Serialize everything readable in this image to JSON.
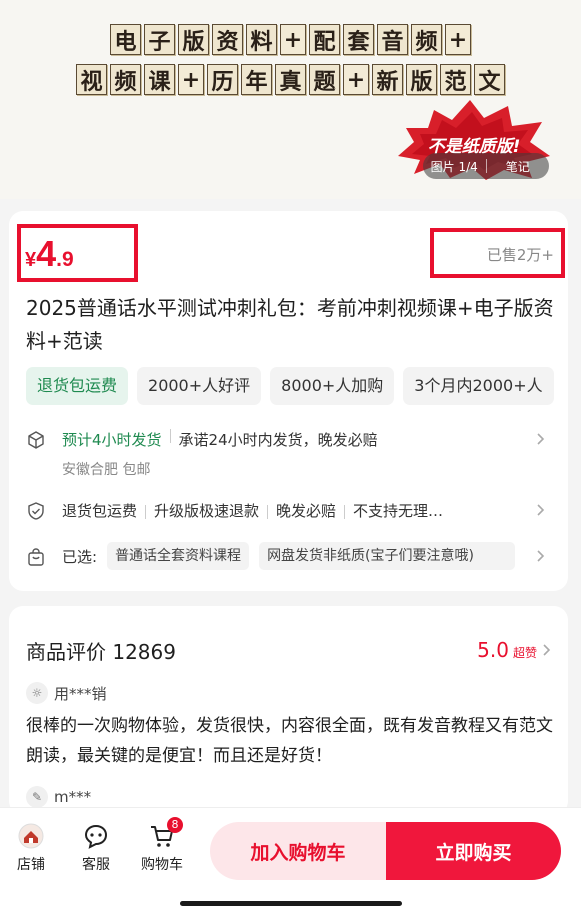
{
  "banner": {
    "title_line1": [
      "电",
      "子",
      "版",
      "资",
      "料",
      "+",
      "配",
      "套",
      "音",
      "频",
      "+"
    ],
    "title_line2": [
      "视",
      "频",
      "课",
      "+",
      "历",
      "年",
      "真",
      "题",
      "+",
      "新",
      "版",
      "范",
      "文"
    ],
    "burst_text": "不是纸质版!",
    "image_counter": "图片 1/4",
    "notes_label": "笔记"
  },
  "product": {
    "currency": "¥",
    "price_int": "4",
    "price_dec": ".9",
    "sold": "已售2万+",
    "title": "2025普通话水平测试冲刺礼包：考前冲刺视频课+电子版资料+范读",
    "tags": [
      "退货包运费",
      "2000+人好评",
      "8000+人加购",
      "3个月内2000+人"
    ],
    "delivery_highlight": "预计4小时发货",
    "delivery_promise": "承诺24小时内发货，晚发必赔",
    "shipping_from": "安徽合肥 包邮",
    "services": [
      "退货包运费",
      "升级版极速退款",
      "晚发必赔",
      "不支持无理…"
    ],
    "selected_label": "已选:",
    "selected_options": [
      "普通话全套资料课程",
      "网盘发货非纸质(宝子们要注意哦)"
    ]
  },
  "reviews": {
    "title": "商品评价 12869",
    "score": "5.0",
    "score_label": "超赞",
    "items": [
      {
        "user": "用***销",
        "text": "很棒的一次购物体验，发货很快，内容很全面，既有发音教程又有范文朗读，最关键的是便宜！而且还是好货！"
      },
      {
        "user": "m***"
      }
    ]
  },
  "bottom_bar": {
    "store": "店铺",
    "service": "客服",
    "cart": "购物车",
    "cart_count": "8",
    "add_to_cart": "加入购物车",
    "buy_now": "立即购买"
  },
  "colors": {
    "accent": "#e8102e",
    "green": "#1f8a50",
    "buy_button": "#f0173c"
  }
}
